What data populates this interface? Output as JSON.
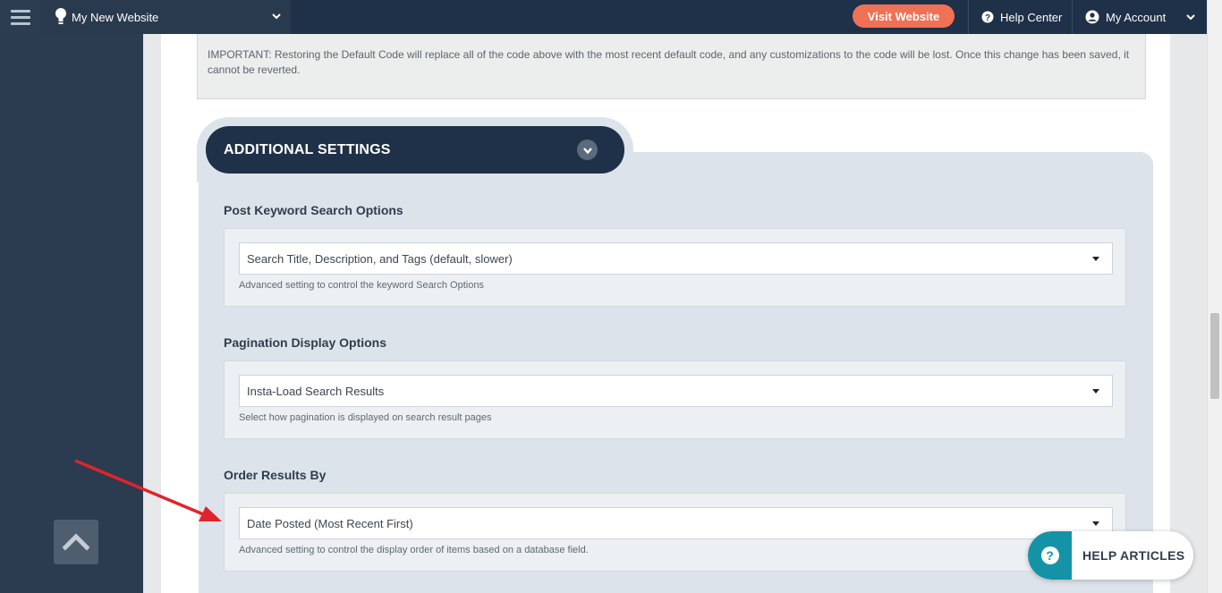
{
  "topbar": {
    "site_name": "My New Website",
    "visit_label": "Visit Website",
    "help_center_label": "Help Center",
    "account_label": "My Account"
  },
  "notice": {
    "text": "IMPORTANT: Restoring the Default Code will replace all of the code above with the most recent default code, and any customizations to the code will be lost. Once this change has been saved, it cannot be reverted."
  },
  "additional_settings": {
    "title": "ADDITIONAL SETTINGS"
  },
  "fields": [
    {
      "label": "Post Keyword Search Options",
      "value": "Search Title, Description, and Tags (default, slower)",
      "help": "Advanced setting to control the keyword Search Options"
    },
    {
      "label": "Pagination Display Options",
      "value": "Insta-Load Search Results",
      "help": "Select how pagination is displayed on search result pages"
    },
    {
      "label": "Order Results By",
      "value": "Date Posted (Most Recent First)",
      "help": "Advanced setting to control the display order of items based on a database field."
    }
  ],
  "help_articles": {
    "label": "HELP ARTICLES"
  },
  "colors": {
    "navy": "#1f3049",
    "visit_button": "#f07156",
    "help_teal": "#1493a6",
    "annotation_arrow": "#e0242b"
  }
}
